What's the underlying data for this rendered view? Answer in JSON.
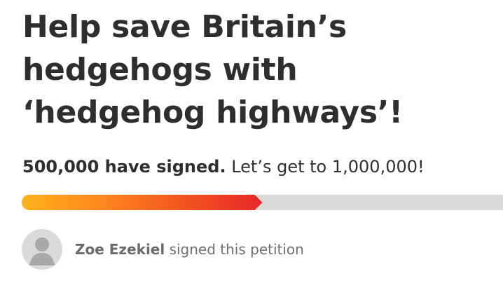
{
  "petition": {
    "title": "Help save Britain’s hedgehogs with ‘hedgehog highways’!",
    "signed_count_text": "500,000 have signed.",
    "goal_text": "Let’s get to 1,000,000!",
    "progress_fraction": 0.5,
    "recent_signer": {
      "name": "Zoe Ezekiel",
      "action_text": "signed this petition",
      "avatar_icon": "user-silhouette-icon"
    }
  },
  "colors": {
    "title": "#2e2e2e",
    "progress_start": "#ffb21b",
    "progress_end": "#e8262b",
    "track": "#d9d9d9",
    "secondary_text": "#6f6f6f"
  }
}
